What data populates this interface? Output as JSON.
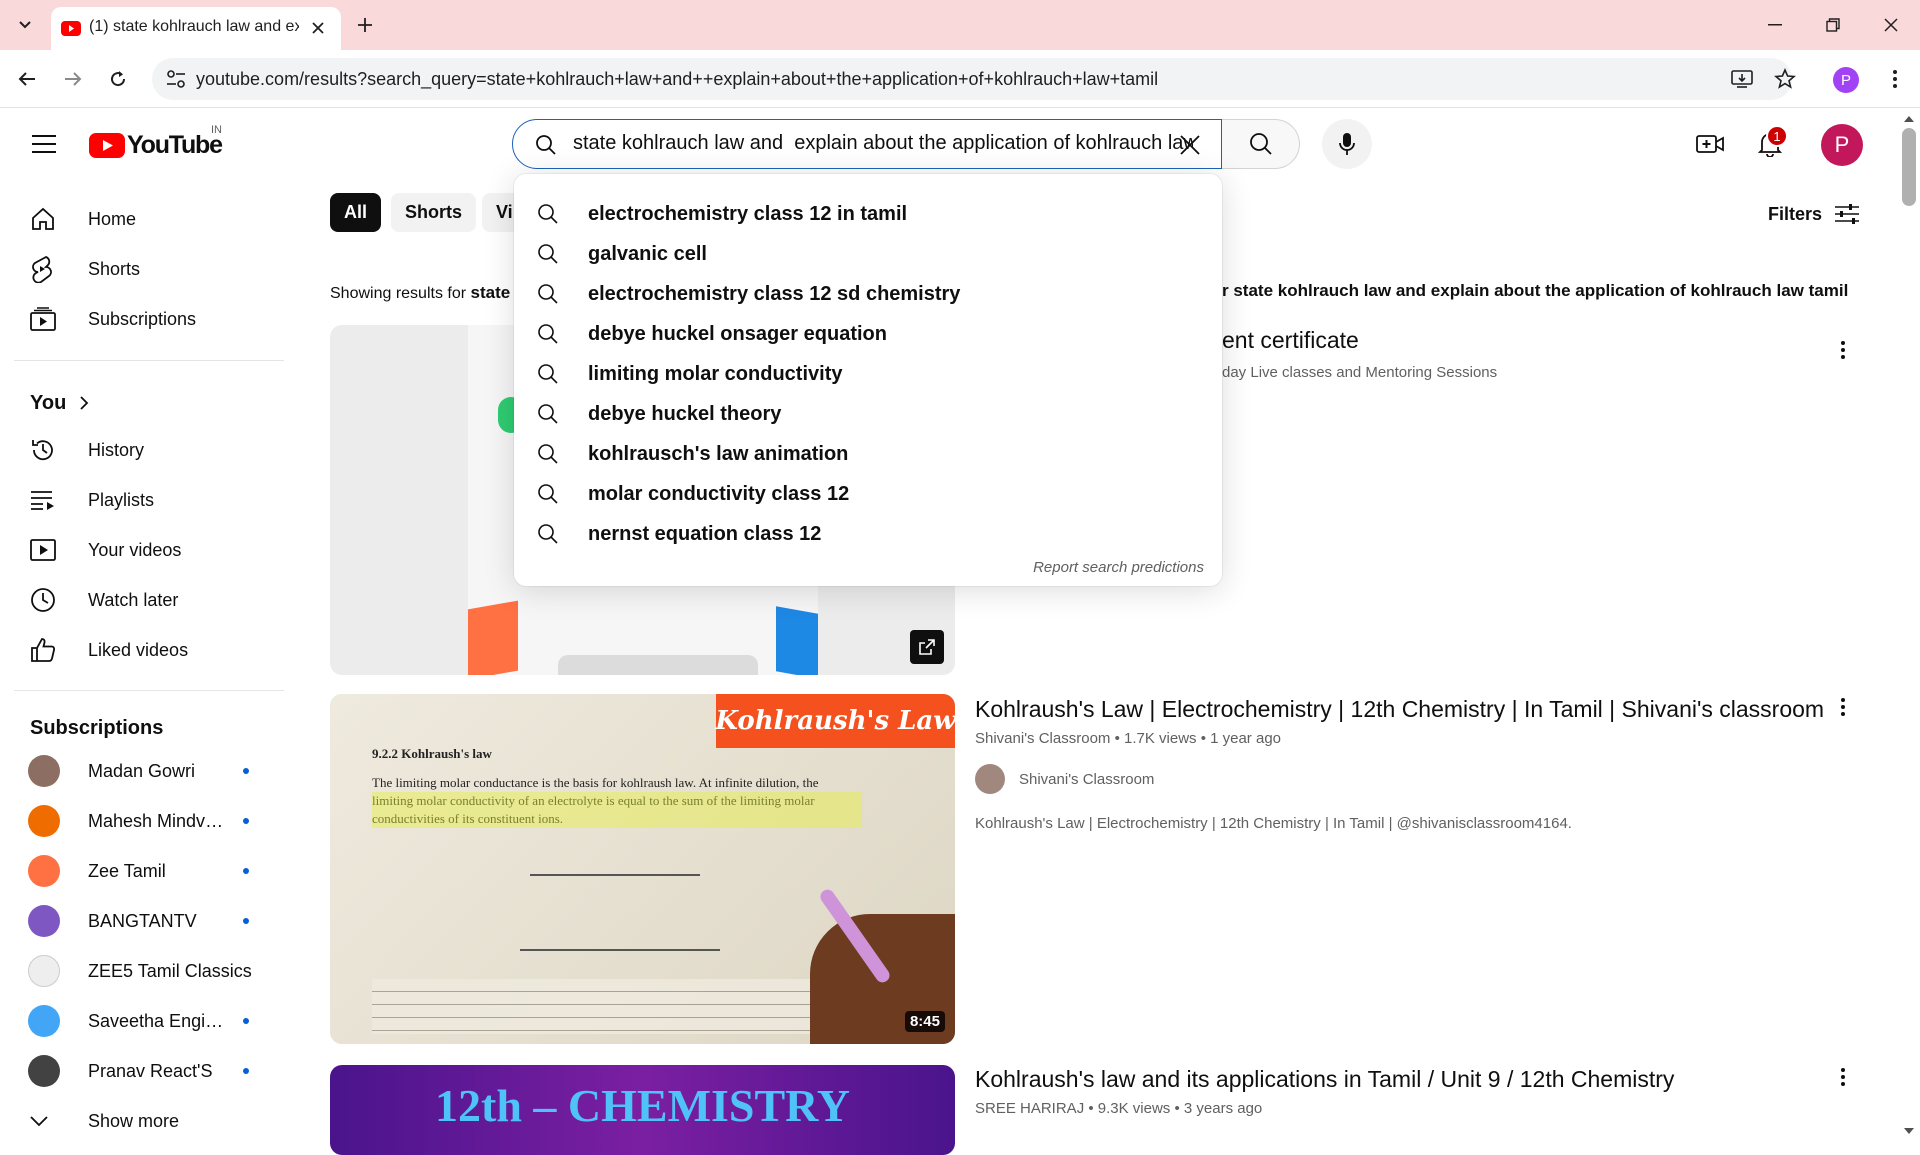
{
  "browser": {
    "tab_title": "(1) state kohlrauch law and expl",
    "url": "youtube.com/results?search_query=state+kohlrauch+law+and++explain+about+the+application+of+kohlrauch+law+tamil",
    "profile_initial": "P"
  },
  "youtube": {
    "logo_text": "YouTube",
    "region": "IN",
    "search_value": "state kohlrauch law and  explain about the application of kohlrauch law tamil",
    "notification_count": "1",
    "avatar_initial": "P"
  },
  "sidebar": {
    "main": [
      {
        "label": "Home",
        "icon": "home-icon"
      },
      {
        "label": "Shorts",
        "icon": "shorts-icon"
      },
      {
        "label": "Subscriptions",
        "icon": "subscriptions-icon"
      }
    ],
    "you_title": "You",
    "you": [
      {
        "label": "History",
        "icon": "history-icon"
      },
      {
        "label": "Playlists",
        "icon": "playlists-icon"
      },
      {
        "label": "Your videos",
        "icon": "your-videos-icon"
      },
      {
        "label": "Watch later",
        "icon": "watch-later-icon"
      },
      {
        "label": "Liked videos",
        "icon": "liked-videos-icon"
      }
    ],
    "subscriptions_title": "Subscriptions",
    "subscriptions": [
      {
        "name": "Madan Gowri",
        "color": "#8d6e63"
      },
      {
        "name": "Mahesh Mindvoi...",
        "color": "#ef6c00"
      },
      {
        "name": "Zee Tamil",
        "color": "#ff7043"
      },
      {
        "name": "BANGTANTV",
        "color": "#7e57c2"
      },
      {
        "name": "ZEE5 Tamil Classics",
        "color": "#eeeeee"
      },
      {
        "name": "Saveetha Engine...",
        "color": "#42a5f5"
      },
      {
        "name": "Pranav React'S",
        "color": "#424242"
      }
    ],
    "show_more": "Show more"
  },
  "chips": [
    "All",
    "Shorts",
    "Vi"
  ],
  "filters_label": "Filters",
  "showing": {
    "prefix": "Showing results for ",
    "query_start": "state k",
    "suffix_bold": "r state kohlrauch law and explain about the application of kohlrauch law tamil"
  },
  "results": [
    {
      "title": "ent certificate",
      "meta": "day Live classes and Mentoring Sessions"
    },
    {
      "title": "Kohlraush's Law | Electrochemistry | 12th Chemistry | In Tamil | Shivani's classroom",
      "meta": "Shivani's Classroom • 1.7K views • 1 year ago",
      "channel": "Shivani's Classroom",
      "description": "Kohlraush's Law | Electrochemistry | 12th Chemistry | In Tamil | @shivanisclassroom4164.",
      "duration": "8:45",
      "thumb_banner": "Kohlraush's Law",
      "thumb_text_1": "9.2.2 Kohlraush's law",
      "thumb_text_2": "The limiting molar conductance is the basis for kohlraush law. At infinite dilution, the limiting molar conductivity of an electrolyte is equal to the sum of the limiting molar conductivities of its constituent ions."
    },
    {
      "title": "Kohlraush's law and its applications in Tamil / Unit 9 / 12th Chemistry",
      "meta": "SREE HARIRAJ • 9.3K views • 3 years ago",
      "thumb_banner": "12th – CHEMISTRY"
    }
  ],
  "suggestions": [
    "electrochemistry class 12 in tamil",
    "galvanic cell",
    "electrochemistry class 12 sd chemistry",
    "debye huckel onsager equation",
    "limiting molar conductivity",
    "debye huckel theory",
    "kohlrausch's law animation",
    "molar conductivity class 12",
    "nernst equation class 12"
  ],
  "report_label": "Report search predictions",
  "colors": {
    "tabstrip": "#f9d9da",
    "yt_red": "#ff0000",
    "search_focus": "#1c62b9",
    "banner_orange": "#f4511e",
    "purple_thumb": "#6a1b9a"
  }
}
